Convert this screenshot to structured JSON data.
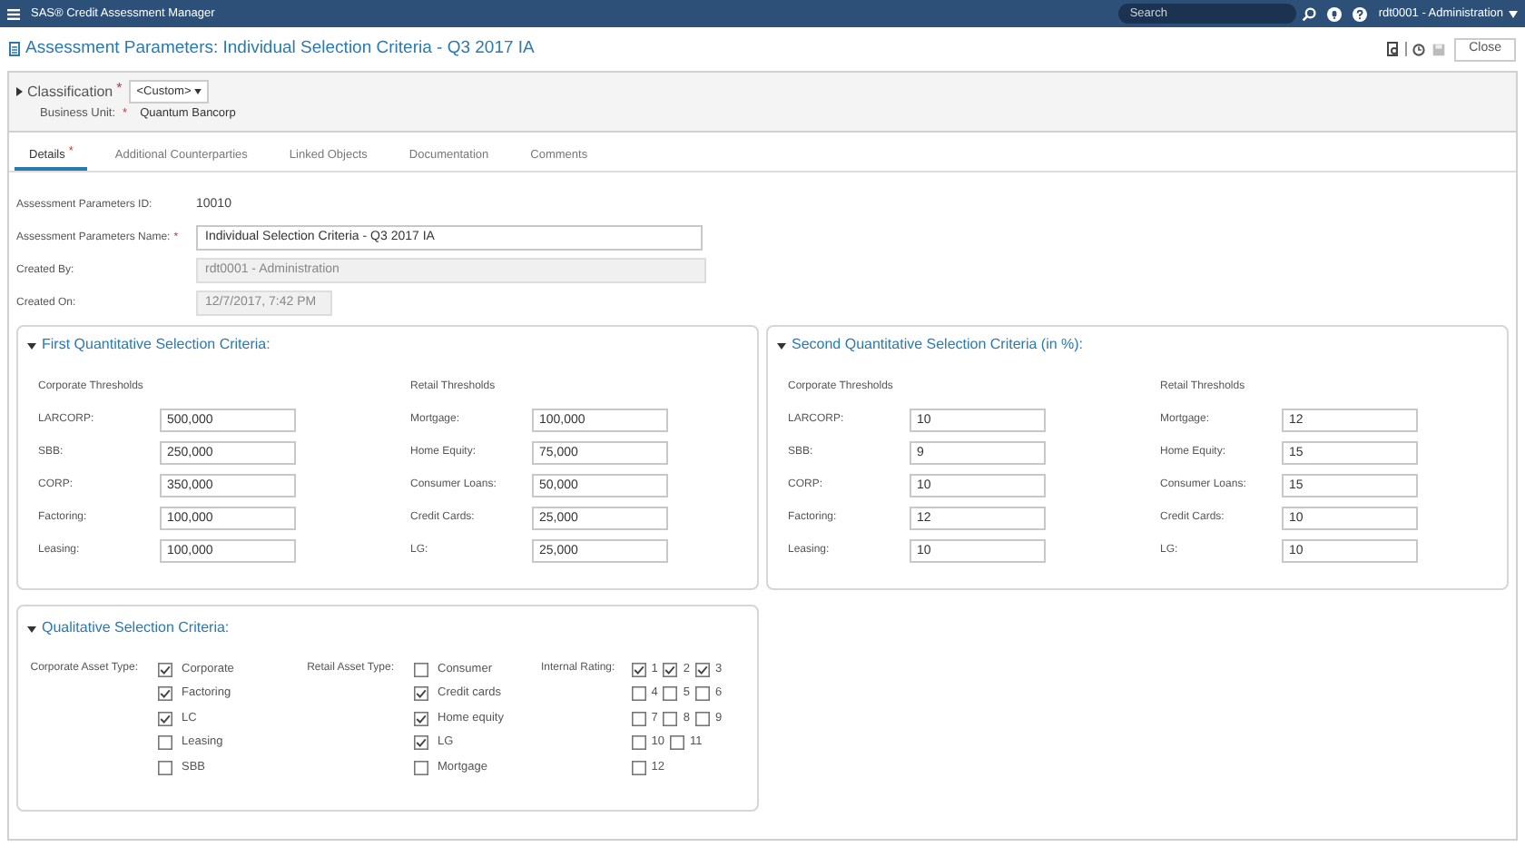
{
  "app_bar": {
    "title": "SAS® Credit Assessment Manager",
    "search": {
      "placeholder": "Search"
    },
    "user": "rdt0001 - Administration"
  },
  "page": {
    "title": "Assessment Parameters: Individual Selection Criteria - Q3 2017 IA",
    "close_button": "Close"
  },
  "classification": {
    "label": "Classification",
    "required_mark": "*",
    "value": "<Custom>",
    "business_unit_label": "Business Unit:",
    "business_unit_required_mark": "*",
    "business_unit": "Quantum Bancorp"
  },
  "tabs": [
    {
      "label": "Details",
      "required_mark": "*",
      "selected": true
    },
    {
      "label": "Additional Counterparties",
      "selected": false
    },
    {
      "label": "Linked Objects",
      "selected": false
    },
    {
      "label": "Documentation",
      "selected": false
    },
    {
      "label": "Comments",
      "selected": false
    }
  ],
  "details": [
    {
      "label": "Assessment Parameters ID:",
      "kind": "text",
      "value": "10010"
    },
    {
      "label": "Assessment Parameters Name:",
      "required_mark": "*",
      "kind": "input",
      "value": "Individual Selection Criteria - Q3 2017 IA"
    },
    {
      "label": "Created By:",
      "kind": "readonly",
      "value": "rdt0001 - Administration"
    },
    {
      "label": "Created On:",
      "kind": "readonly_short",
      "value": "12/7/2017, 7:42 PM"
    }
  ],
  "quantitative_sections": [
    {
      "title": "First Quantitative Selection Criteria:",
      "expanded": true,
      "groups": [
        {
          "heading": "Corporate Thresholds",
          "fields": [
            {
              "label": "LARCORP:",
              "value": "500,000"
            },
            {
              "label": "SBB:",
              "value": "250,000"
            },
            {
              "label": "CORP:",
              "value": "350,000"
            },
            {
              "label": "Factoring:",
              "value": "100,000"
            },
            {
              "label": "Leasing:",
              "value": "100,000"
            }
          ]
        },
        {
          "heading": "Retail Thresholds",
          "fields": [
            {
              "label": "Mortgage:",
              "value": "100,000"
            },
            {
              "label": "Home Equity:",
              "value": "75,000"
            },
            {
              "label": "Consumer Loans:",
              "value": "50,000"
            },
            {
              "label": "Credit Cards:",
              "value": "25,000"
            },
            {
              "label": "LG:",
              "value": "25,000"
            }
          ]
        }
      ]
    },
    {
      "title": "Second Quantitative Selection Criteria (in %):",
      "expanded": true,
      "groups": [
        {
          "heading": "Corporate Thresholds",
          "fields": [
            {
              "label": "LARCORP:",
              "value": "10"
            },
            {
              "label": "SBB:",
              "value": "9"
            },
            {
              "label": "CORP:",
              "value": "10"
            },
            {
              "label": "Factoring:",
              "value": "12"
            },
            {
              "label": "Leasing:",
              "value": "10"
            }
          ]
        },
        {
          "heading": "Retail Thresholds",
          "fields": [
            {
              "label": "Mortgage:",
              "value": "12"
            },
            {
              "label": "Home Equity:",
              "value": "15"
            },
            {
              "label": "Consumer Loans:",
              "value": "15"
            },
            {
              "label": "Credit Cards:",
              "value": "10"
            },
            {
              "label": "LG:",
              "value": "10"
            }
          ]
        }
      ]
    }
  ],
  "qualitative_section": {
    "title": "Qualitative Selection Criteria:",
    "expanded": true,
    "corporate_asset_type": {
      "label": "Corporate Asset Type:",
      "options": [
        {
          "label": "Corporate",
          "checked": true
        },
        {
          "label": "Factoring",
          "checked": true
        },
        {
          "label": "LC",
          "checked": true
        },
        {
          "label": "Leasing",
          "checked": false
        },
        {
          "label": "SBB",
          "checked": false
        }
      ]
    },
    "retail_asset_type": {
      "label": "Retail Asset Type:",
      "options": [
        {
          "label": "Consumer",
          "checked": false
        },
        {
          "label": "Credit cards",
          "checked": true
        },
        {
          "label": "Home equity",
          "checked": true
        },
        {
          "label": "LG",
          "checked": true
        },
        {
          "label": "Mortgage",
          "checked": false
        }
      ]
    },
    "internal_rating": {
      "label": "Internal Rating:",
      "rows": [
        [
          {
            "label": "1",
            "checked": true
          },
          {
            "label": "2",
            "checked": true
          },
          {
            "label": "3",
            "checked": true
          }
        ],
        [
          {
            "label": "4",
            "checked": false
          },
          {
            "label": "5",
            "checked": false
          },
          {
            "label": "6",
            "checked": false
          }
        ],
        [
          {
            "label": "7",
            "checked": false
          },
          {
            "label": "8",
            "checked": false
          },
          {
            "label": "9",
            "checked": false
          }
        ],
        [
          {
            "label": "10",
            "checked": false
          },
          {
            "label": "11",
            "checked": false
          }
        ],
        [
          {
            "label": "12",
            "checked": false
          }
        ]
      ]
    }
  }
}
